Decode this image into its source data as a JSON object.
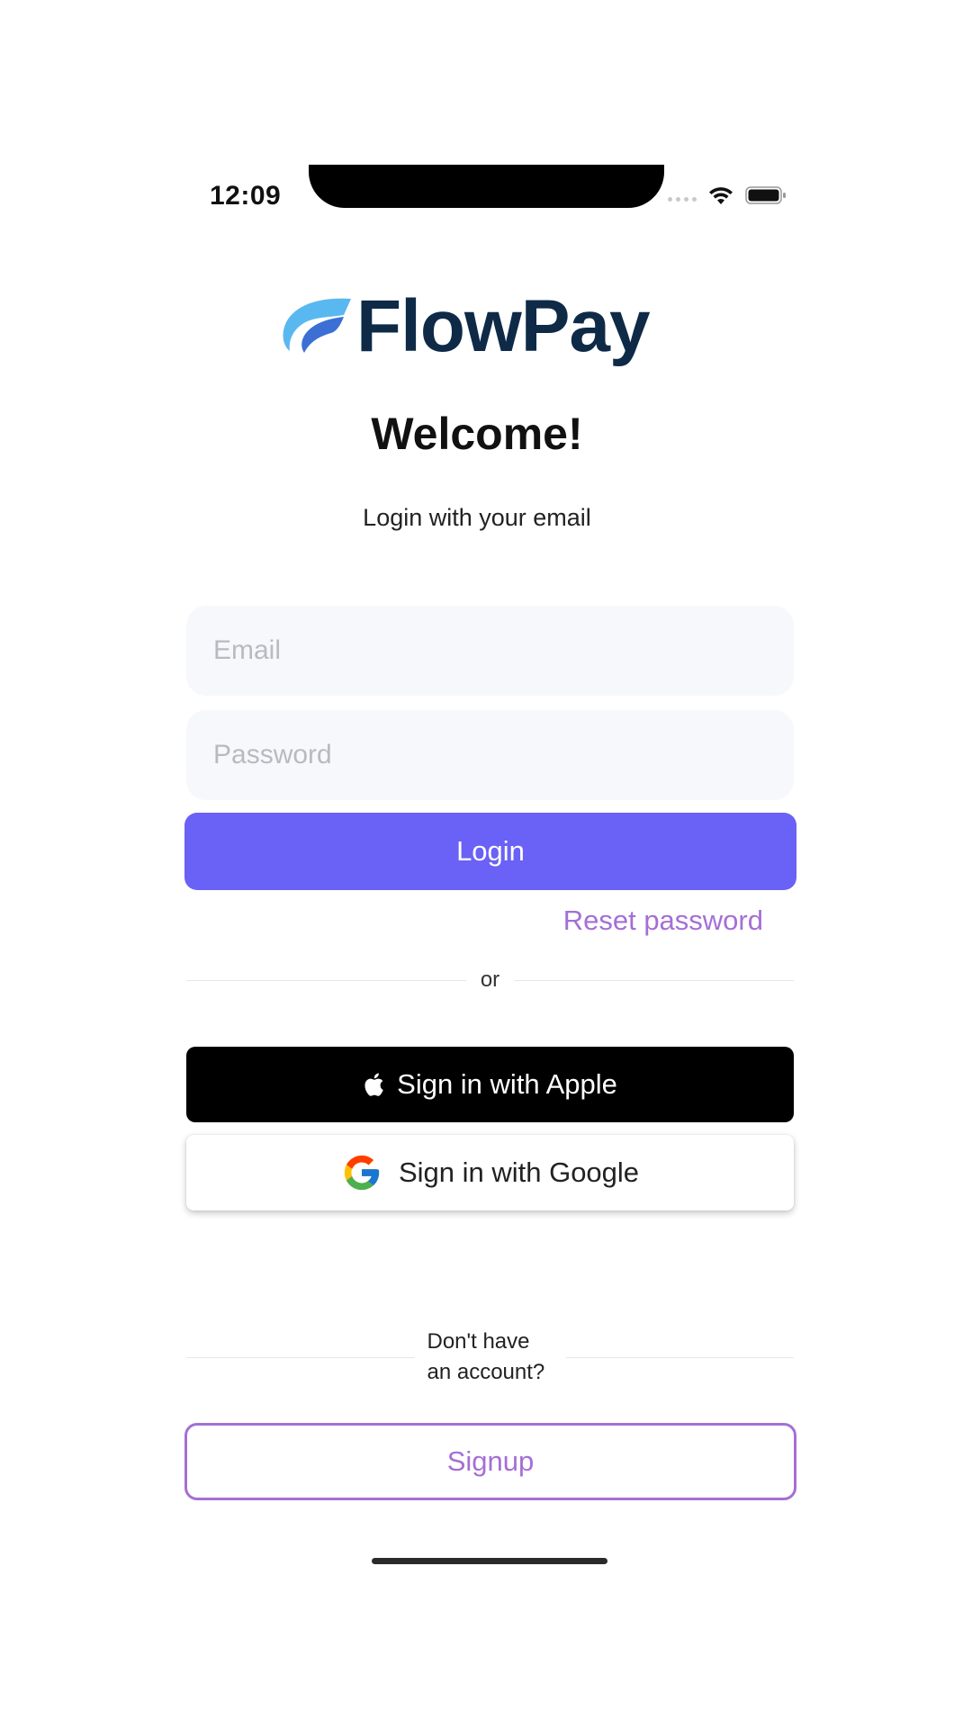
{
  "status_bar": {
    "time": "12:09",
    "wifi_icon": "wifi-icon",
    "battery_icon": "battery-icon"
  },
  "logo": {
    "text": "FlowPay",
    "brand_color": "#0e2a47",
    "mark_colors": [
      "#5ab8f0",
      "#3b6fd4"
    ]
  },
  "welcome": {
    "title": "Welcome!",
    "subtitle": "Login with your email"
  },
  "form": {
    "email_placeholder": "Email",
    "email_value": "",
    "password_placeholder": "Password",
    "password_value": "",
    "login_label": "Login",
    "reset_label": "Reset password"
  },
  "divider": {
    "or_text": "or"
  },
  "social": {
    "apple_label": "Sign in with Apple",
    "apple_icon": "apple-icon",
    "google_label": "Sign in with Google",
    "google_icon": "google-icon"
  },
  "signup": {
    "prompt_line1": "Don't have",
    "prompt_line2": "an account?",
    "label": "Signup"
  },
  "colors": {
    "primary": "#6a61f6",
    "accent": "#a46fd6",
    "field_bg": "#f7f8fc"
  }
}
